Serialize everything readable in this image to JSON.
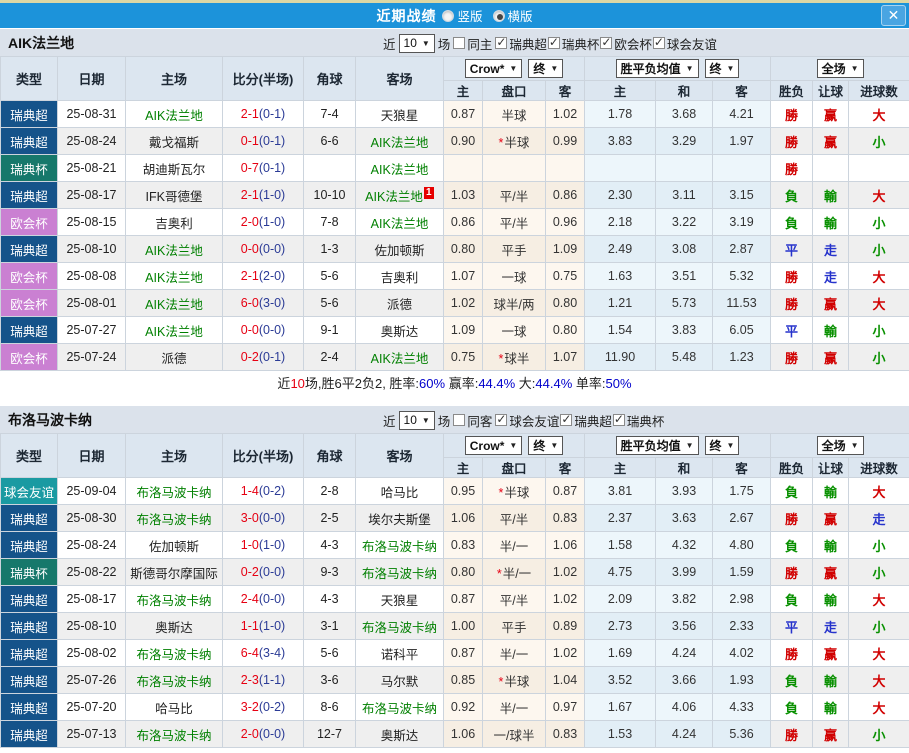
{
  "palette": {
    "top_bar": "#1c93da",
    "header_bg": "#dce6f0",
    "section_header_bg": "#dbe2eb",
    "focus_team_green": "#008000",
    "score_red": "#e60012",
    "half_score_navy": "#2b3b96",
    "result_red": "#d10000",
    "result_green": "#089000",
    "result_blue": "#2633cc",
    "league_colors": {
      "瑞典超": "#15538a",
      "瑞典杯": "#16786b",
      "欧会杯": "#ca80d2",
      "球会友谊": "#1a9aa2"
    }
  },
  "top_bar": {
    "title": "近期战绩",
    "options": [
      {
        "label": "竖版",
        "selected": false
      },
      {
        "label": "横版",
        "selected": true
      }
    ],
    "close_glyph": "✕"
  },
  "columns": [
    "类型",
    "日期",
    "主场",
    "比分(半场)",
    "角球",
    "客场",
    "主",
    "盘口",
    "客",
    "主",
    "和",
    "客",
    "胜负",
    "让球",
    "进球数"
  ],
  "group_selects": {
    "crow": "Crow*",
    "crow_late": "终",
    "avg": "胜平负均值",
    "avg_late": "终",
    "scope": "全场",
    "arrow": "▼"
  },
  "sections": [
    {
      "team": "AIK法兰地",
      "controls": {
        "near_label": "近",
        "count": "10",
        "matches_label": "场",
        "venue_label": "同主",
        "venue_checked": false,
        "leagues": [
          {
            "label": "瑞典超",
            "checked": true
          },
          {
            "label": "瑞典杯",
            "checked": true
          },
          {
            "label": "欧会杯",
            "checked": true
          },
          {
            "label": "球会友谊",
            "checked": true
          }
        ]
      },
      "rows": [
        {
          "league": "瑞典超",
          "date": "25-08-31",
          "home": "AIK法兰地",
          "home_focus": true,
          "score": "2-1",
          "half": "(0-1)",
          "corner": "7-4",
          "away": "天狼星",
          "away_focus": false,
          "away_badge": "",
          "crow_home": "0.87",
          "handicap": "半球",
          "star": false,
          "crow_away": "1.02",
          "avg_home": "1.78",
          "avg_draw": "3.68",
          "avg_away": "4.21",
          "outcome": {
            "t": "勝",
            "k": "r"
          },
          "let": {
            "t": "赢",
            "k": "r"
          },
          "goal": {
            "t": "大",
            "k": "r"
          }
        },
        {
          "league": "瑞典超",
          "date": "25-08-24",
          "home": "戴戈福斯",
          "home_focus": false,
          "score": "0-1",
          "half": "(0-1)",
          "corner": "6-6",
          "away": "AIK法兰地",
          "away_focus": true,
          "away_badge": "",
          "crow_home": "0.90",
          "handicap": "半球",
          "star": true,
          "crow_away": "0.99",
          "avg_home": "3.83",
          "avg_draw": "3.29",
          "avg_away": "1.97",
          "outcome": {
            "t": "勝",
            "k": "r"
          },
          "let": {
            "t": "赢",
            "k": "r"
          },
          "goal": {
            "t": "小",
            "k": "g"
          }
        },
        {
          "league": "瑞典杯",
          "date": "25-08-21",
          "home": "胡迪斯瓦尔",
          "home_focus": false,
          "score": "0-7",
          "half": "(0-1)",
          "corner": "",
          "away": "AIK法兰地",
          "away_focus": true,
          "away_badge": "",
          "crow_home": "",
          "handicap": "",
          "star": false,
          "crow_away": "",
          "avg_home": "",
          "avg_draw": "",
          "avg_away": "",
          "outcome": {
            "t": "勝",
            "k": "r"
          },
          "let": {
            "t": "",
            "k": ""
          },
          "goal": {
            "t": "",
            "k": ""
          }
        },
        {
          "league": "瑞典超",
          "date": "25-08-17",
          "home": "IFK哥德堡",
          "home_focus": false,
          "score": "2-1",
          "half": "(1-0)",
          "corner": "10-10",
          "away": "AIK法兰地",
          "away_focus": true,
          "away_badge": "1",
          "crow_home": "1.03",
          "handicap": "平/半",
          "star": false,
          "crow_away": "0.86",
          "avg_home": "2.30",
          "avg_draw": "3.11",
          "avg_away": "3.15",
          "outcome": {
            "t": "負",
            "k": "g"
          },
          "let": {
            "t": "輸",
            "k": "g"
          },
          "goal": {
            "t": "大",
            "k": "r"
          }
        },
        {
          "league": "欧会杯",
          "date": "25-08-15",
          "home": "吉奥利",
          "home_focus": false,
          "score": "2-0",
          "half": "(1-0)",
          "corner": "7-8",
          "away": "AIK法兰地",
          "away_focus": true,
          "away_badge": "",
          "crow_home": "0.86",
          "handicap": "平/半",
          "star": false,
          "crow_away": "0.96",
          "avg_home": "2.18",
          "avg_draw": "3.22",
          "avg_away": "3.19",
          "outcome": {
            "t": "負",
            "k": "g"
          },
          "let": {
            "t": "輸",
            "k": "g"
          },
          "goal": {
            "t": "小",
            "k": "g"
          }
        },
        {
          "league": "瑞典超",
          "date": "25-08-10",
          "home": "AIK法兰地",
          "home_focus": true,
          "score": "0-0",
          "half": "(0-0)",
          "corner": "1-3",
          "away": "佐加顿斯",
          "away_focus": false,
          "away_badge": "",
          "crow_home": "0.80",
          "handicap": "平手",
          "star": false,
          "crow_away": "1.09",
          "avg_home": "2.49",
          "avg_draw": "3.08",
          "avg_away": "2.87",
          "outcome": {
            "t": "平",
            "k": "b"
          },
          "let": {
            "t": "走",
            "k": "b"
          },
          "goal": {
            "t": "小",
            "k": "g"
          }
        },
        {
          "league": "欧会杯",
          "date": "25-08-08",
          "home": "AIK法兰地",
          "home_focus": true,
          "score": "2-1",
          "half": "(2-0)",
          "corner": "5-6",
          "away": "吉奥利",
          "away_focus": false,
          "away_badge": "",
          "crow_home": "1.07",
          "handicap": "一球",
          "star": false,
          "crow_away": "0.75",
          "avg_home": "1.63",
          "avg_draw": "3.51",
          "avg_away": "5.32",
          "outcome": {
            "t": "勝",
            "k": "r"
          },
          "let": {
            "t": "走",
            "k": "b"
          },
          "goal": {
            "t": "大",
            "k": "r"
          }
        },
        {
          "league": "欧会杯",
          "date": "25-08-01",
          "home": "AIK法兰地",
          "home_focus": true,
          "score": "6-0",
          "half": "(3-0)",
          "corner": "5-6",
          "away": "派德",
          "away_focus": false,
          "away_badge": "",
          "crow_home": "1.02",
          "handicap": "球半/两",
          "star": false,
          "crow_away": "0.80",
          "avg_home": "1.21",
          "avg_draw": "5.73",
          "avg_away": "11.53",
          "outcome": {
            "t": "勝",
            "k": "r"
          },
          "let": {
            "t": "赢",
            "k": "r"
          },
          "goal": {
            "t": "大",
            "k": "r"
          }
        },
        {
          "league": "瑞典超",
          "date": "25-07-27",
          "home": "AIK法兰地",
          "home_focus": true,
          "score": "0-0",
          "half": "(0-0)",
          "corner": "9-1",
          "away": "奥斯达",
          "away_focus": false,
          "away_badge": "",
          "crow_home": "1.09",
          "handicap": "一球",
          "star": false,
          "crow_away": "0.80",
          "avg_home": "1.54",
          "avg_draw": "3.83",
          "avg_away": "6.05",
          "outcome": {
            "t": "平",
            "k": "b"
          },
          "let": {
            "t": "輸",
            "k": "g"
          },
          "goal": {
            "t": "小",
            "k": "g"
          }
        },
        {
          "league": "欧会杯",
          "date": "25-07-24",
          "home": "派德",
          "home_focus": false,
          "score": "0-2",
          "half": "(0-1)",
          "corner": "2-4",
          "away": "AIK法兰地",
          "away_focus": true,
          "away_badge": "",
          "crow_home": "0.75",
          "handicap": "球半",
          "star": true,
          "crow_away": "1.07",
          "avg_home": "11.90",
          "avg_draw": "5.48",
          "avg_away": "1.23",
          "outcome": {
            "t": "勝",
            "k": "r"
          },
          "let": {
            "t": "赢",
            "k": "r"
          },
          "goal": {
            "t": "小",
            "k": "g"
          }
        }
      ],
      "summary": [
        {
          "t": "近",
          "c": "d"
        },
        {
          "t": "10",
          "c": "r"
        },
        {
          "t": "场,胜6平2负2, 胜率:",
          "c": "d"
        },
        {
          "t": "60%",
          "c": "b"
        },
        {
          "t": " 赢率:",
          "c": "d"
        },
        {
          "t": "44.4%",
          "c": "b"
        },
        {
          "t": " 大:",
          "c": "d"
        },
        {
          "t": "44.4%",
          "c": "b"
        },
        {
          "t": " 单率:",
          "c": "d"
        },
        {
          "t": "50%",
          "c": "b"
        }
      ]
    },
    {
      "team": "布洛马波卡纳",
      "controls": {
        "near_label": "近",
        "count": "10",
        "matches_label": "场",
        "venue_label": "同客",
        "venue_checked": false,
        "leagues": [
          {
            "label": "球会友谊",
            "checked": true
          },
          {
            "label": "瑞典超",
            "checked": true
          },
          {
            "label": "瑞典杯",
            "checked": true
          }
        ]
      },
      "rows": [
        {
          "league": "球会友谊",
          "date": "25-09-04",
          "home": "布洛马波卡纳",
          "home_focus": true,
          "score": "1-4",
          "half": "(0-2)",
          "corner": "2-8",
          "away": "哈马比",
          "away_focus": false,
          "away_badge": "",
          "crow_home": "0.95",
          "handicap": "半球",
          "star": true,
          "crow_away": "0.87",
          "avg_home": "3.81",
          "avg_draw": "3.93",
          "avg_away": "1.75",
          "outcome": {
            "t": "負",
            "k": "g"
          },
          "let": {
            "t": "輸",
            "k": "g"
          },
          "goal": {
            "t": "大",
            "k": "r"
          }
        },
        {
          "league": "瑞典超",
          "date": "25-08-30",
          "home": "布洛马波卡纳",
          "home_focus": true,
          "score": "3-0",
          "half": "(0-0)",
          "corner": "2-5",
          "away": "埃尔夫斯堡",
          "away_focus": false,
          "away_badge": "",
          "crow_home": "1.06",
          "handicap": "平/半",
          "star": false,
          "crow_away": "0.83",
          "avg_home": "2.37",
          "avg_draw": "3.63",
          "avg_away": "2.67",
          "outcome": {
            "t": "勝",
            "k": "r"
          },
          "let": {
            "t": "赢",
            "k": "r"
          },
          "goal": {
            "t": "走",
            "k": "b"
          }
        },
        {
          "league": "瑞典超",
          "date": "25-08-24",
          "home": "佐加顿斯",
          "home_focus": false,
          "score": "1-0",
          "half": "(1-0)",
          "corner": "4-3",
          "away": "布洛马波卡纳",
          "away_focus": true,
          "away_badge": "",
          "crow_home": "0.83",
          "handicap": "半/一",
          "star": false,
          "crow_away": "1.06",
          "avg_home": "1.58",
          "avg_draw": "4.32",
          "avg_away": "4.80",
          "outcome": {
            "t": "負",
            "k": "g"
          },
          "let": {
            "t": "輸",
            "k": "g"
          },
          "goal": {
            "t": "小",
            "k": "g"
          }
        },
        {
          "league": "瑞典杯",
          "date": "25-08-22",
          "home": "斯德哥尔摩国际",
          "home_focus": false,
          "score": "0-2",
          "half": "(0-0)",
          "corner": "9-3",
          "away": "布洛马波卡纳",
          "away_focus": true,
          "away_badge": "",
          "crow_home": "0.80",
          "handicap": "半/一",
          "star": true,
          "crow_away": "1.02",
          "avg_home": "4.75",
          "avg_draw": "3.99",
          "avg_away": "1.59",
          "outcome": {
            "t": "勝",
            "k": "r"
          },
          "let": {
            "t": "赢",
            "k": "r"
          },
          "goal": {
            "t": "小",
            "k": "g"
          }
        },
        {
          "league": "瑞典超",
          "date": "25-08-17",
          "home": "布洛马波卡纳",
          "home_focus": true,
          "score": "2-4",
          "half": "(0-0)",
          "corner": "4-3",
          "away": "天狼星",
          "away_focus": false,
          "away_badge": "",
          "crow_home": "0.87",
          "handicap": "平/半",
          "star": false,
          "crow_away": "1.02",
          "avg_home": "2.09",
          "avg_draw": "3.82",
          "avg_away": "2.98",
          "outcome": {
            "t": "負",
            "k": "g"
          },
          "let": {
            "t": "輸",
            "k": "g"
          },
          "goal": {
            "t": "大",
            "k": "r"
          }
        },
        {
          "league": "瑞典超",
          "date": "25-08-10",
          "home": "奥斯达",
          "home_focus": false,
          "score": "1-1",
          "half": "(1-0)",
          "corner": "3-1",
          "away": "布洛马波卡纳",
          "away_focus": true,
          "away_badge": "",
          "crow_home": "1.00",
          "handicap": "平手",
          "star": false,
          "crow_away": "0.89",
          "avg_home": "2.73",
          "avg_draw": "3.56",
          "avg_away": "2.33",
          "outcome": {
            "t": "平",
            "k": "b"
          },
          "let": {
            "t": "走",
            "k": "b"
          },
          "goal": {
            "t": "小",
            "k": "g"
          }
        },
        {
          "league": "瑞典超",
          "date": "25-08-02",
          "home": "布洛马波卡纳",
          "home_focus": true,
          "score": "6-4",
          "half": "(3-4)",
          "corner": "5-6",
          "away": "诺科平",
          "away_focus": false,
          "away_badge": "",
          "crow_home": "0.87",
          "handicap": "半/一",
          "star": false,
          "crow_away": "1.02",
          "avg_home": "1.69",
          "avg_draw": "4.24",
          "avg_away": "4.02",
          "outcome": {
            "t": "勝",
            "k": "r"
          },
          "let": {
            "t": "赢",
            "k": "r"
          },
          "goal": {
            "t": "大",
            "k": "r"
          }
        },
        {
          "league": "瑞典超",
          "date": "25-07-26",
          "home": "布洛马波卡纳",
          "home_focus": true,
          "score": "2-3",
          "half": "(1-1)",
          "corner": "3-6",
          "away": "马尔默",
          "away_focus": false,
          "away_badge": "",
          "crow_home": "0.85",
          "handicap": "半球",
          "star": true,
          "crow_away": "1.04",
          "avg_home": "3.52",
          "avg_draw": "3.66",
          "avg_away": "1.93",
          "outcome": {
            "t": "負",
            "k": "g"
          },
          "let": {
            "t": "輸",
            "k": "g"
          },
          "goal": {
            "t": "大",
            "k": "r"
          }
        },
        {
          "league": "瑞典超",
          "date": "25-07-20",
          "home": "哈马比",
          "home_focus": false,
          "score": "3-2",
          "half": "(0-2)",
          "corner": "8-6",
          "away": "布洛马波卡纳",
          "away_focus": true,
          "away_badge": "",
          "crow_home": "0.92",
          "handicap": "半/一",
          "star": false,
          "crow_away": "0.97",
          "avg_home": "1.67",
          "avg_draw": "4.06",
          "avg_away": "4.33",
          "outcome": {
            "t": "負",
            "k": "g"
          },
          "let": {
            "t": "輸",
            "k": "g"
          },
          "goal": {
            "t": "大",
            "k": "r"
          }
        },
        {
          "league": "瑞典超",
          "date": "25-07-13",
          "home": "布洛马波卡纳",
          "home_focus": true,
          "score": "2-0",
          "half": "(0-0)",
          "corner": "12-7",
          "away": "奥斯达",
          "away_focus": false,
          "away_badge": "",
          "crow_home": "1.06",
          "handicap": "一/球半",
          "star": false,
          "crow_away": "0.83",
          "avg_home": "1.53",
          "avg_draw": "4.24",
          "avg_away": "5.36",
          "outcome": {
            "t": "勝",
            "k": "r"
          },
          "let": {
            "t": "赢",
            "k": "r"
          },
          "goal": {
            "t": "小",
            "k": "g"
          }
        }
      ],
      "summary": null
    }
  ]
}
